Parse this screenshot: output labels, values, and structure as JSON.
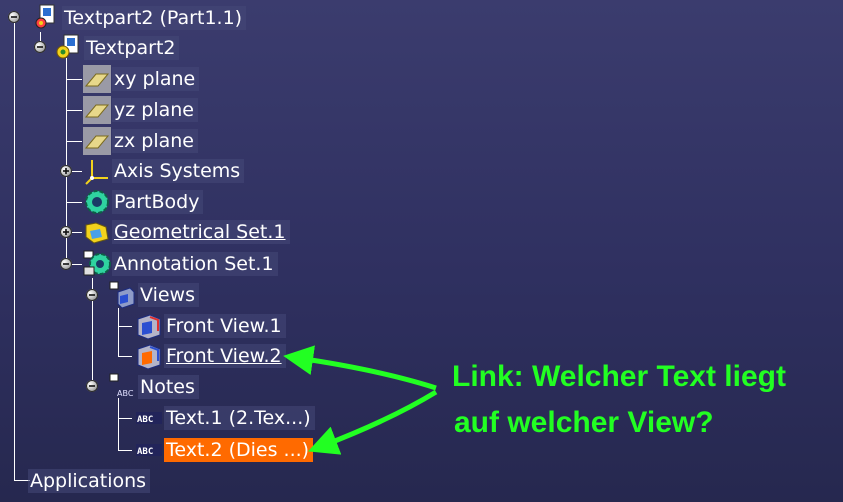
{
  "tree": {
    "root_label": "Textpart2 (Part1.1)",
    "part_label": "Textpart2",
    "xy_plane": "xy plane",
    "yz_plane": "yz plane",
    "zx_plane": "zx plane",
    "axis_systems": "Axis Systems",
    "part_body": "PartBody",
    "geometrical_set": "Geometrical Set.1",
    "annotation_set": "Annotation Set.1",
    "views": "Views",
    "front_view_1": "Front View.1",
    "front_view_2": "Front View.2",
    "notes": "Notes",
    "text_1": "Text.1 (2.Tex...)",
    "text_2": "Text.2 (Dies ...)",
    "applications": "Applications"
  },
  "annotation": {
    "line1": "Link: Welcher Text liegt",
    "line2": "auf welcher View?",
    "color": "#22ff22"
  },
  "colors": {
    "selected": "#ff6a00",
    "background": "#34356a"
  }
}
